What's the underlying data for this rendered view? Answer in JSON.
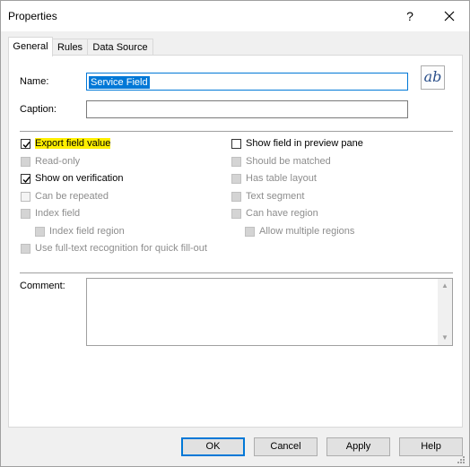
{
  "window": {
    "title": "Properties",
    "help_glyph": "?"
  },
  "tabs": [
    {
      "label": "General",
      "active": true
    },
    {
      "label": "Rules",
      "active": false
    },
    {
      "label": "Data Source",
      "active": false
    }
  ],
  "form": {
    "name_label": "Name:",
    "name_value": "Service Field",
    "caption_label": "Caption:",
    "caption_value": "",
    "comment_label": "Comment:",
    "comment_value": "",
    "font_button_text": "ab"
  },
  "checkboxes_left": [
    {
      "label": "Export field value",
      "checked": true,
      "enabled": true,
      "highlighted": true
    },
    {
      "label": "Read-only",
      "checked": true,
      "enabled": false
    },
    {
      "label": "Show on verification",
      "checked": true,
      "enabled": true
    },
    {
      "label": "Can be repeated",
      "checked": false,
      "enabled": false
    },
    {
      "label": "Index field",
      "checked": true,
      "enabled": false
    },
    {
      "label": "Index field region",
      "checked": true,
      "enabled": false
    },
    {
      "label": "Use full-text recognition for quick fill-out",
      "checked": true,
      "enabled": false
    }
  ],
  "checkboxes_right": [
    {
      "label": "Show field in preview pane",
      "checked": false,
      "enabled": true
    },
    {
      "label": "Should be matched",
      "checked": true,
      "enabled": false
    },
    {
      "label": "Has table layout",
      "checked": true,
      "enabled": false
    },
    {
      "label": "Text segment",
      "checked": true,
      "enabled": false
    },
    {
      "label": "Can have region",
      "checked": true,
      "enabled": false
    },
    {
      "label": "Allow multiple regions",
      "checked": true,
      "enabled": false
    }
  ],
  "buttons": {
    "ok": "OK",
    "cancel": "Cancel",
    "apply": "Apply",
    "help": "Help"
  },
  "colors": {
    "accent": "#0078d7",
    "highlight": "#ffef00"
  }
}
